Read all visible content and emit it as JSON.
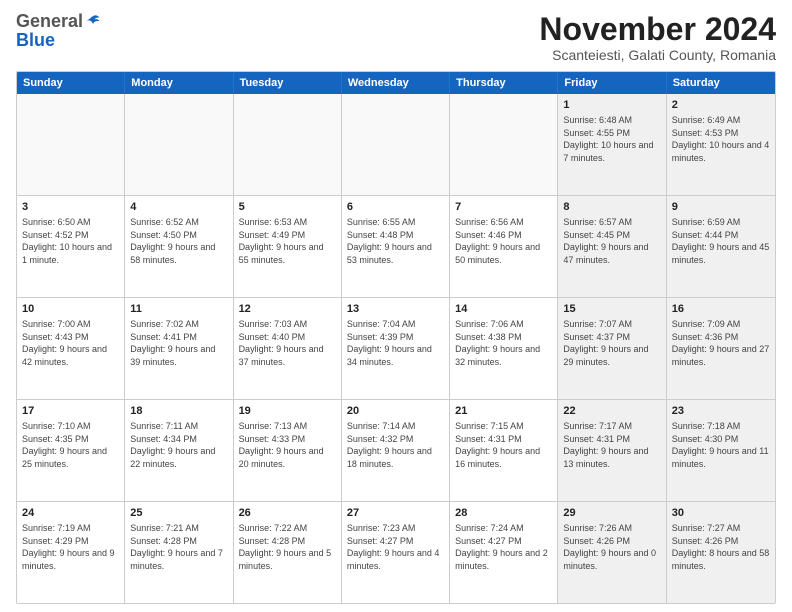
{
  "header": {
    "logo_general": "General",
    "logo_blue": "Blue",
    "main_title": "November 2024",
    "subtitle": "Scanteiesti, Galati County, Romania"
  },
  "calendar": {
    "weekdays": [
      "Sunday",
      "Monday",
      "Tuesday",
      "Wednesday",
      "Thursday",
      "Friday",
      "Saturday"
    ],
    "rows": [
      [
        {
          "day": "",
          "info": "",
          "empty": true
        },
        {
          "day": "",
          "info": "",
          "empty": true
        },
        {
          "day": "",
          "info": "",
          "empty": true
        },
        {
          "day": "",
          "info": "",
          "empty": true
        },
        {
          "day": "",
          "info": "",
          "empty": true
        },
        {
          "day": "1",
          "info": "Sunrise: 6:48 AM\nSunset: 4:55 PM\nDaylight: 10 hours and 7 minutes.",
          "shaded": true
        },
        {
          "day": "2",
          "info": "Sunrise: 6:49 AM\nSunset: 4:53 PM\nDaylight: 10 hours and 4 minutes.",
          "shaded": true
        }
      ],
      [
        {
          "day": "3",
          "info": "Sunrise: 6:50 AM\nSunset: 4:52 PM\nDaylight: 10 hours and 1 minute."
        },
        {
          "day": "4",
          "info": "Sunrise: 6:52 AM\nSunset: 4:50 PM\nDaylight: 9 hours and 58 minutes."
        },
        {
          "day": "5",
          "info": "Sunrise: 6:53 AM\nSunset: 4:49 PM\nDaylight: 9 hours and 55 minutes."
        },
        {
          "day": "6",
          "info": "Sunrise: 6:55 AM\nSunset: 4:48 PM\nDaylight: 9 hours and 53 minutes."
        },
        {
          "day": "7",
          "info": "Sunrise: 6:56 AM\nSunset: 4:46 PM\nDaylight: 9 hours and 50 minutes."
        },
        {
          "day": "8",
          "info": "Sunrise: 6:57 AM\nSunset: 4:45 PM\nDaylight: 9 hours and 47 minutes.",
          "shaded": true
        },
        {
          "day": "9",
          "info": "Sunrise: 6:59 AM\nSunset: 4:44 PM\nDaylight: 9 hours and 45 minutes.",
          "shaded": true
        }
      ],
      [
        {
          "day": "10",
          "info": "Sunrise: 7:00 AM\nSunset: 4:43 PM\nDaylight: 9 hours and 42 minutes."
        },
        {
          "day": "11",
          "info": "Sunrise: 7:02 AM\nSunset: 4:41 PM\nDaylight: 9 hours and 39 minutes."
        },
        {
          "day": "12",
          "info": "Sunrise: 7:03 AM\nSunset: 4:40 PM\nDaylight: 9 hours and 37 minutes."
        },
        {
          "day": "13",
          "info": "Sunrise: 7:04 AM\nSunset: 4:39 PM\nDaylight: 9 hours and 34 minutes."
        },
        {
          "day": "14",
          "info": "Sunrise: 7:06 AM\nSunset: 4:38 PM\nDaylight: 9 hours and 32 minutes."
        },
        {
          "day": "15",
          "info": "Sunrise: 7:07 AM\nSunset: 4:37 PM\nDaylight: 9 hours and 29 minutes.",
          "shaded": true
        },
        {
          "day": "16",
          "info": "Sunrise: 7:09 AM\nSunset: 4:36 PM\nDaylight: 9 hours and 27 minutes.",
          "shaded": true
        }
      ],
      [
        {
          "day": "17",
          "info": "Sunrise: 7:10 AM\nSunset: 4:35 PM\nDaylight: 9 hours and 25 minutes."
        },
        {
          "day": "18",
          "info": "Sunrise: 7:11 AM\nSunset: 4:34 PM\nDaylight: 9 hours and 22 minutes."
        },
        {
          "day": "19",
          "info": "Sunrise: 7:13 AM\nSunset: 4:33 PM\nDaylight: 9 hours and 20 minutes."
        },
        {
          "day": "20",
          "info": "Sunrise: 7:14 AM\nSunset: 4:32 PM\nDaylight: 9 hours and 18 minutes."
        },
        {
          "day": "21",
          "info": "Sunrise: 7:15 AM\nSunset: 4:31 PM\nDaylight: 9 hours and 16 minutes."
        },
        {
          "day": "22",
          "info": "Sunrise: 7:17 AM\nSunset: 4:31 PM\nDaylight: 9 hours and 13 minutes.",
          "shaded": true
        },
        {
          "day": "23",
          "info": "Sunrise: 7:18 AM\nSunset: 4:30 PM\nDaylight: 9 hours and 11 minutes.",
          "shaded": true
        }
      ],
      [
        {
          "day": "24",
          "info": "Sunrise: 7:19 AM\nSunset: 4:29 PM\nDaylight: 9 hours and 9 minutes."
        },
        {
          "day": "25",
          "info": "Sunrise: 7:21 AM\nSunset: 4:28 PM\nDaylight: 9 hours and 7 minutes."
        },
        {
          "day": "26",
          "info": "Sunrise: 7:22 AM\nSunset: 4:28 PM\nDaylight: 9 hours and 5 minutes."
        },
        {
          "day": "27",
          "info": "Sunrise: 7:23 AM\nSunset: 4:27 PM\nDaylight: 9 hours and 4 minutes."
        },
        {
          "day": "28",
          "info": "Sunrise: 7:24 AM\nSunset: 4:27 PM\nDaylight: 9 hours and 2 minutes."
        },
        {
          "day": "29",
          "info": "Sunrise: 7:26 AM\nSunset: 4:26 PM\nDaylight: 9 hours and 0 minutes.",
          "shaded": true
        },
        {
          "day": "30",
          "info": "Sunrise: 7:27 AM\nSunset: 4:26 PM\nDaylight: 8 hours and 58 minutes.",
          "shaded": true
        }
      ]
    ]
  }
}
